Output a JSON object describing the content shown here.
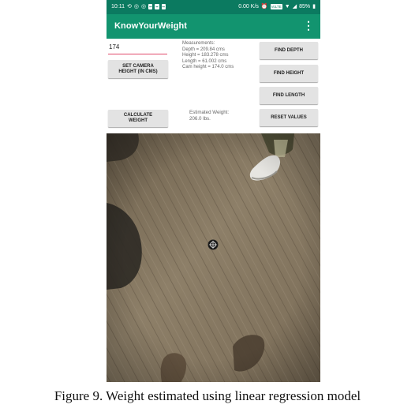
{
  "status_bar": {
    "time": "10:11",
    "network_speed": "0.00 K/s",
    "battery": "85%",
    "icons": [
      "sync-icon",
      "notification-icon",
      "notification-icon",
      "badge-icon",
      "badge-icon",
      "badge-icon",
      "alarm-icon",
      "volte-icon",
      "wifi-icon",
      "signal-icon",
      "battery-icon"
    ]
  },
  "app_bar": {
    "title": "KnowYourWeight",
    "menu_icon": "more-vert-icon"
  },
  "controls": {
    "camera_height_input": "174",
    "set_camera_height_button": "SET CAMERA\nHEIGHT (IN CMS)",
    "calculate_weight_button": "CALCULATE\nWEIGHT",
    "find_depth_button": "FIND DEPTH",
    "find_height_button": "FIND HEIGHT",
    "find_length_button": "FIND LENGTH",
    "reset_values_button": "RESET VALUES"
  },
  "measurements": {
    "title": "Measurements:",
    "depth": "Depth =  209.84 cms",
    "height": "Height = 183.278 cms",
    "length": "Length = 61.002 cms",
    "cam_height": "Cam height = 174.0 cms"
  },
  "estimate": {
    "label": "Estimated Weight:",
    "value": "206.0 lbs."
  },
  "camera_view": {
    "crosshair_icon": "crosshair-icon"
  },
  "caption": "Figure 9. Weight estimated using linear regression model",
  "colors": {
    "status_bar": "#0b7a60",
    "app_bar": "#12946f",
    "input_underline": "#e04a6a",
    "button_bg": "#e3e3e3"
  }
}
